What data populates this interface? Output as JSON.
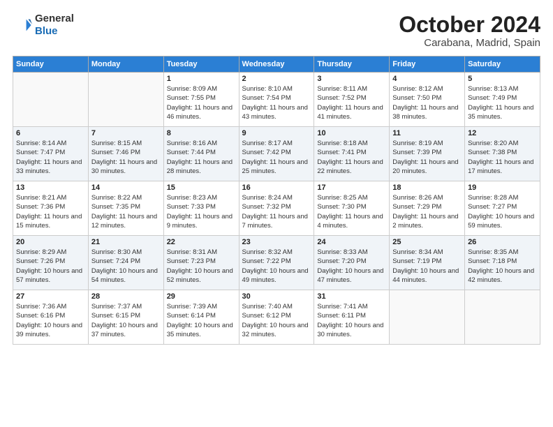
{
  "header": {
    "logo_line1": "General",
    "logo_line2": "Blue",
    "title": "October 2024",
    "subtitle": "Carabana, Madrid, Spain"
  },
  "weekdays": [
    "Sunday",
    "Monday",
    "Tuesday",
    "Wednesday",
    "Thursday",
    "Friday",
    "Saturday"
  ],
  "weeks": [
    [
      {
        "day": "",
        "info": ""
      },
      {
        "day": "",
        "info": ""
      },
      {
        "day": "1",
        "info": "Sunrise: 8:09 AM\nSunset: 7:55 PM\nDaylight: 11 hours and 46 minutes."
      },
      {
        "day": "2",
        "info": "Sunrise: 8:10 AM\nSunset: 7:54 PM\nDaylight: 11 hours and 43 minutes."
      },
      {
        "day": "3",
        "info": "Sunrise: 8:11 AM\nSunset: 7:52 PM\nDaylight: 11 hours and 41 minutes."
      },
      {
        "day": "4",
        "info": "Sunrise: 8:12 AM\nSunset: 7:50 PM\nDaylight: 11 hours and 38 minutes."
      },
      {
        "day": "5",
        "info": "Sunrise: 8:13 AM\nSunset: 7:49 PM\nDaylight: 11 hours and 35 minutes."
      }
    ],
    [
      {
        "day": "6",
        "info": "Sunrise: 8:14 AM\nSunset: 7:47 PM\nDaylight: 11 hours and 33 minutes."
      },
      {
        "day": "7",
        "info": "Sunrise: 8:15 AM\nSunset: 7:46 PM\nDaylight: 11 hours and 30 minutes."
      },
      {
        "day": "8",
        "info": "Sunrise: 8:16 AM\nSunset: 7:44 PM\nDaylight: 11 hours and 28 minutes."
      },
      {
        "day": "9",
        "info": "Sunrise: 8:17 AM\nSunset: 7:42 PM\nDaylight: 11 hours and 25 minutes."
      },
      {
        "day": "10",
        "info": "Sunrise: 8:18 AM\nSunset: 7:41 PM\nDaylight: 11 hours and 22 minutes."
      },
      {
        "day": "11",
        "info": "Sunrise: 8:19 AM\nSunset: 7:39 PM\nDaylight: 11 hours and 20 minutes."
      },
      {
        "day": "12",
        "info": "Sunrise: 8:20 AM\nSunset: 7:38 PM\nDaylight: 11 hours and 17 minutes."
      }
    ],
    [
      {
        "day": "13",
        "info": "Sunrise: 8:21 AM\nSunset: 7:36 PM\nDaylight: 11 hours and 15 minutes."
      },
      {
        "day": "14",
        "info": "Sunrise: 8:22 AM\nSunset: 7:35 PM\nDaylight: 11 hours and 12 minutes."
      },
      {
        "day": "15",
        "info": "Sunrise: 8:23 AM\nSunset: 7:33 PM\nDaylight: 11 hours and 9 minutes."
      },
      {
        "day": "16",
        "info": "Sunrise: 8:24 AM\nSunset: 7:32 PM\nDaylight: 11 hours and 7 minutes."
      },
      {
        "day": "17",
        "info": "Sunrise: 8:25 AM\nSunset: 7:30 PM\nDaylight: 11 hours and 4 minutes."
      },
      {
        "day": "18",
        "info": "Sunrise: 8:26 AM\nSunset: 7:29 PM\nDaylight: 11 hours and 2 minutes."
      },
      {
        "day": "19",
        "info": "Sunrise: 8:28 AM\nSunset: 7:27 PM\nDaylight: 10 hours and 59 minutes."
      }
    ],
    [
      {
        "day": "20",
        "info": "Sunrise: 8:29 AM\nSunset: 7:26 PM\nDaylight: 10 hours and 57 minutes."
      },
      {
        "day": "21",
        "info": "Sunrise: 8:30 AM\nSunset: 7:24 PM\nDaylight: 10 hours and 54 minutes."
      },
      {
        "day": "22",
        "info": "Sunrise: 8:31 AM\nSunset: 7:23 PM\nDaylight: 10 hours and 52 minutes."
      },
      {
        "day": "23",
        "info": "Sunrise: 8:32 AM\nSunset: 7:22 PM\nDaylight: 10 hours and 49 minutes."
      },
      {
        "day": "24",
        "info": "Sunrise: 8:33 AM\nSunset: 7:20 PM\nDaylight: 10 hours and 47 minutes."
      },
      {
        "day": "25",
        "info": "Sunrise: 8:34 AM\nSunset: 7:19 PM\nDaylight: 10 hours and 44 minutes."
      },
      {
        "day": "26",
        "info": "Sunrise: 8:35 AM\nSunset: 7:18 PM\nDaylight: 10 hours and 42 minutes."
      }
    ],
    [
      {
        "day": "27",
        "info": "Sunrise: 7:36 AM\nSunset: 6:16 PM\nDaylight: 10 hours and 39 minutes."
      },
      {
        "day": "28",
        "info": "Sunrise: 7:37 AM\nSunset: 6:15 PM\nDaylight: 10 hours and 37 minutes."
      },
      {
        "day": "29",
        "info": "Sunrise: 7:39 AM\nSunset: 6:14 PM\nDaylight: 10 hours and 35 minutes."
      },
      {
        "day": "30",
        "info": "Sunrise: 7:40 AM\nSunset: 6:12 PM\nDaylight: 10 hours and 32 minutes."
      },
      {
        "day": "31",
        "info": "Sunrise: 7:41 AM\nSunset: 6:11 PM\nDaylight: 10 hours and 30 minutes."
      },
      {
        "day": "",
        "info": ""
      },
      {
        "day": "",
        "info": ""
      }
    ]
  ]
}
